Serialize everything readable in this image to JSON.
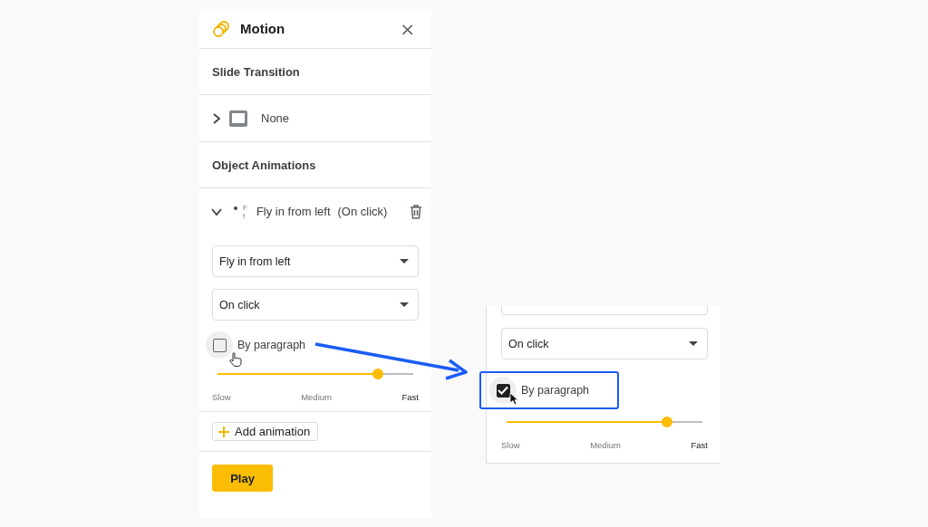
{
  "panel": {
    "title": "Motion",
    "close_glyph": "×",
    "slide_transition": {
      "heading": "Slide Transition",
      "expanded": false,
      "value": "None"
    },
    "object_animations": {
      "heading": "Object Animations",
      "items": [
        {
          "expanded": true,
          "thumbnail_text": [
            "F",
            "t"
          ],
          "label": "Fly in from left",
          "trigger": "(On click)",
          "effect": "Fly in from left",
          "start": "On click",
          "by_paragraph_label": "By paragraph",
          "by_paragraph": false,
          "speed": {
            "level": 0.82
          },
          "speed_labels": [
            "Slow",
            "Medium",
            "Fast"
          ]
        }
      ]
    },
    "add_button": "Add animation",
    "play_button": "Play"
  },
  "zoomed_inset": {
    "start": "On click",
    "by_paragraph_label": "By paragraph",
    "by_paragraph": true,
    "highlighted": true,
    "speed": {
      "level": 0.82
    },
    "speed_labels": [
      "Slow",
      "Medium",
      "Fast"
    ]
  }
}
